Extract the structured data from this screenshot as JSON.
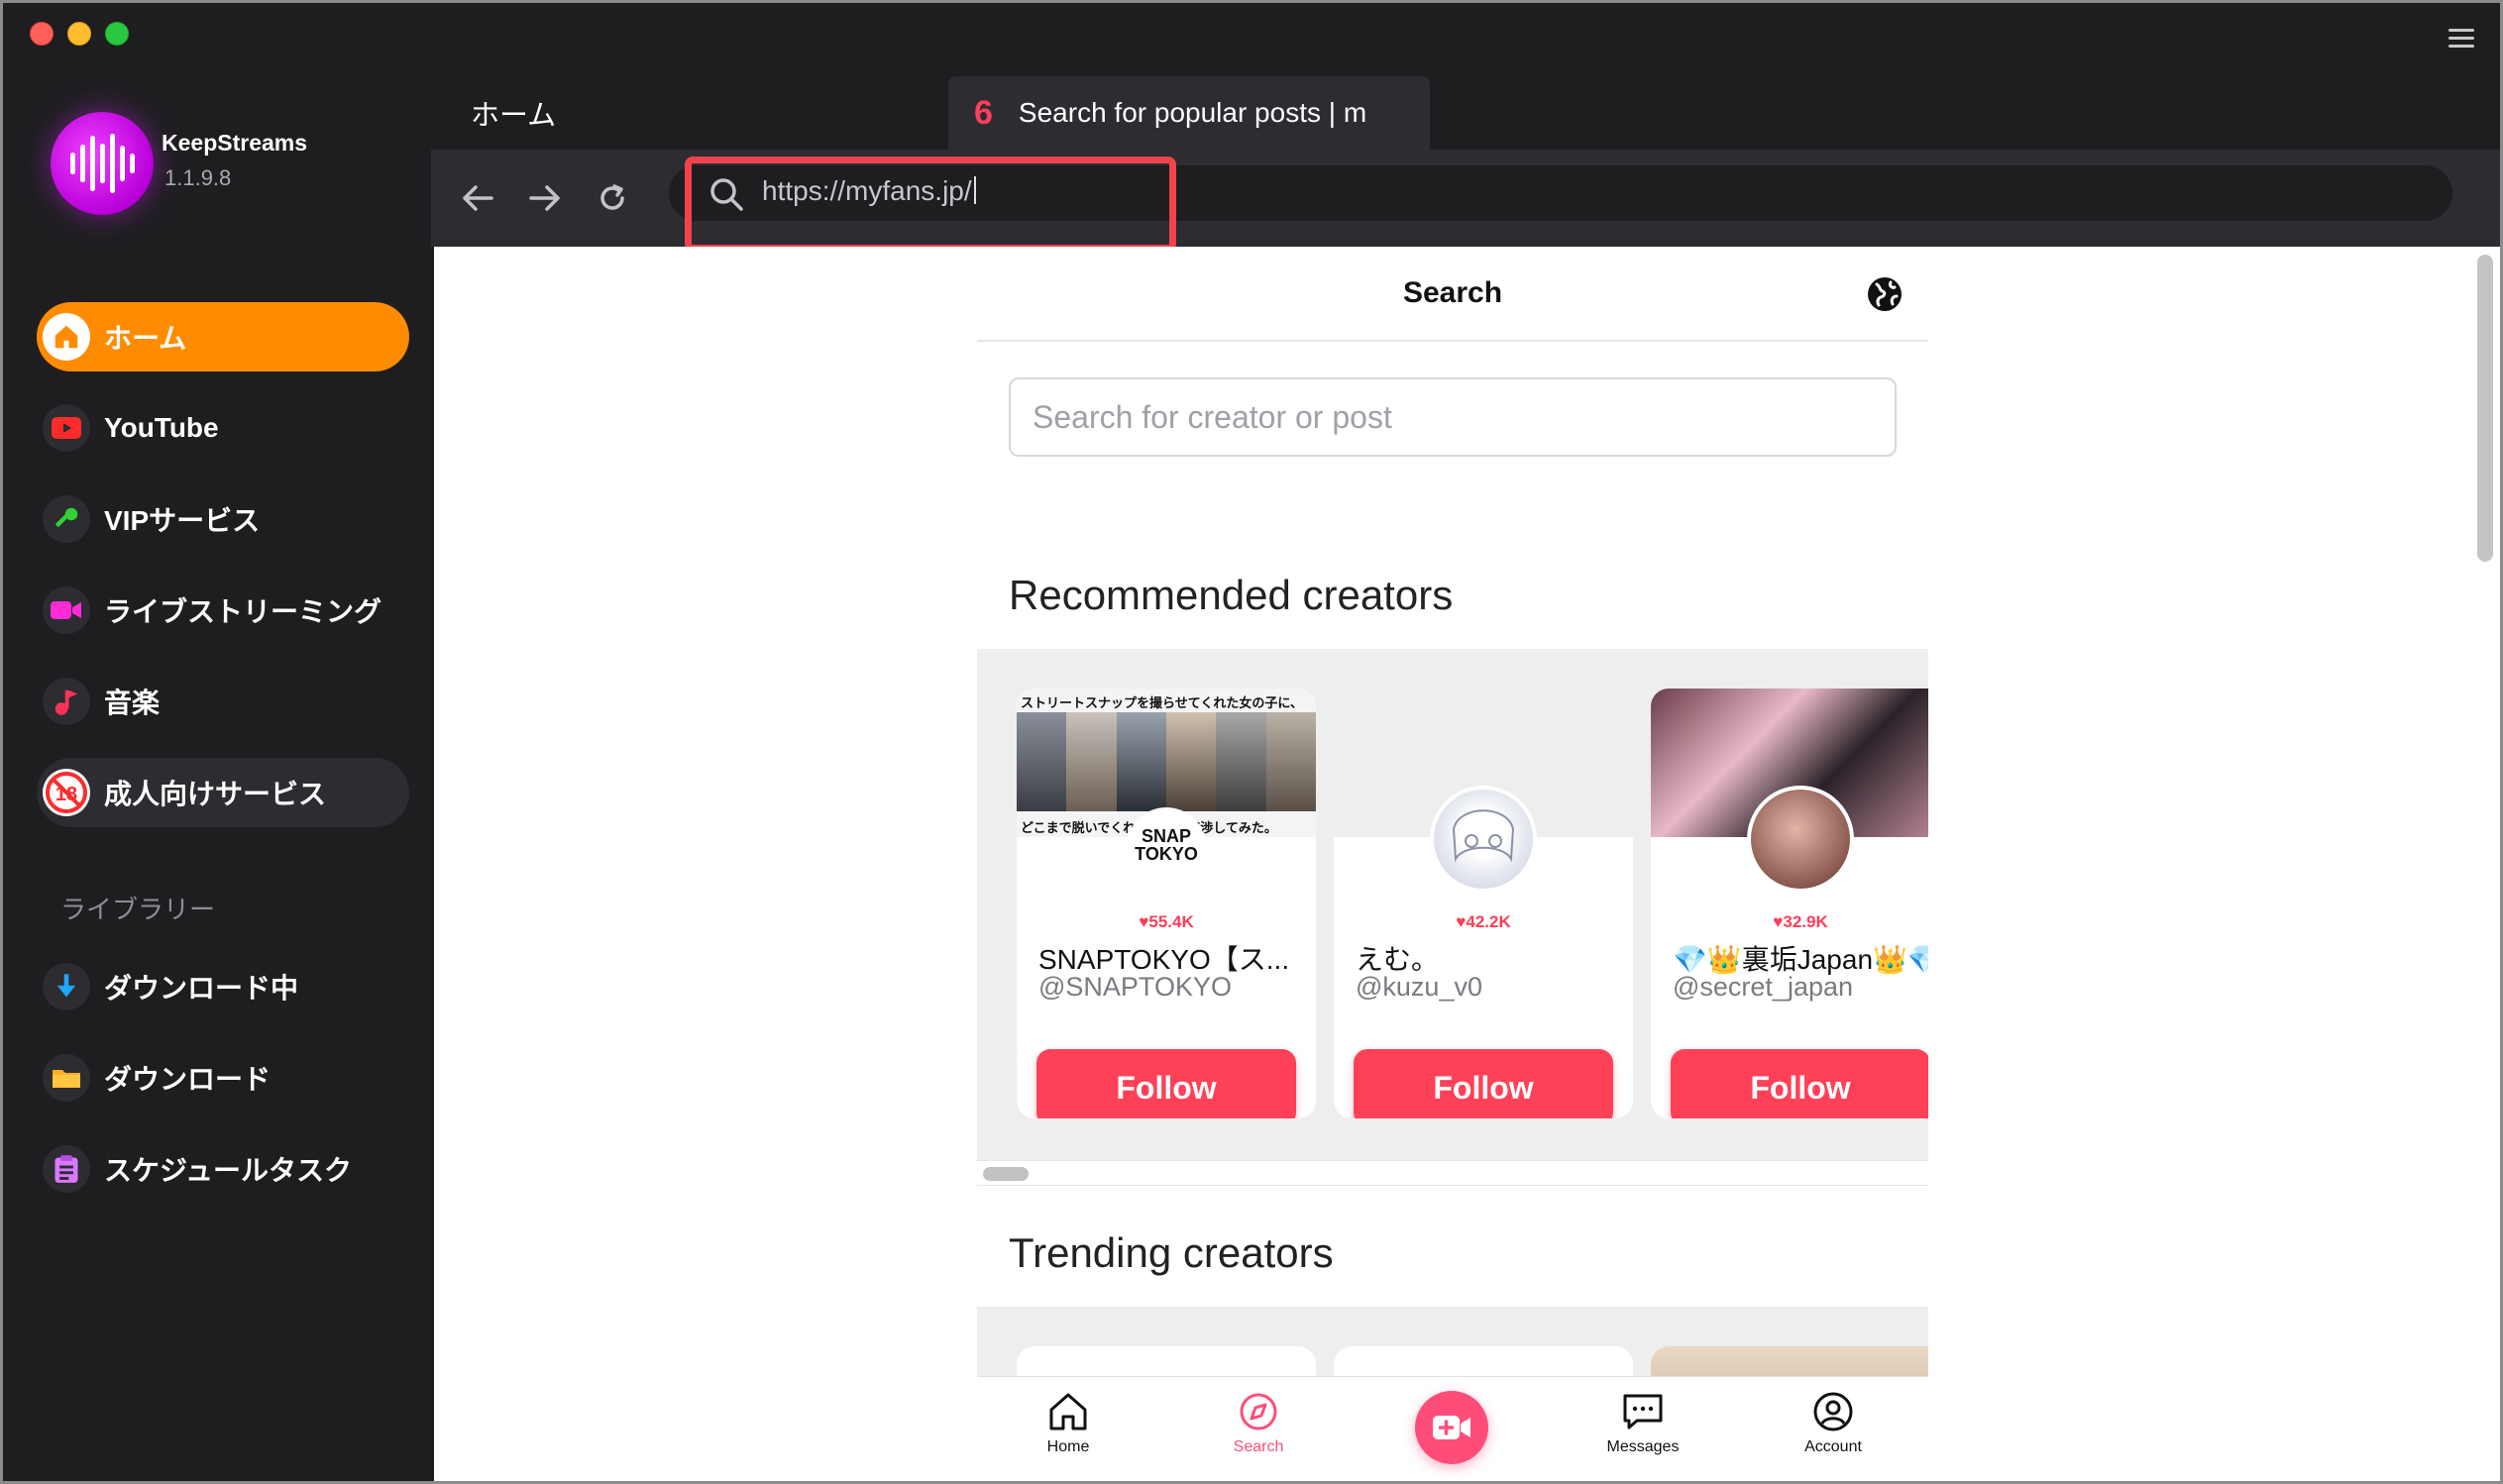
{
  "app": {
    "name": "KeepStreams",
    "version": "1.1.9.8"
  },
  "sidebar": {
    "items": [
      {
        "label": "ホーム",
        "icon": "home-icon"
      },
      {
        "label": "YouTube",
        "icon": "youtube-icon"
      },
      {
        "label": "VIPサービス",
        "icon": "key-icon"
      },
      {
        "label": "ライブストリーミング",
        "icon": "video-camera-icon"
      },
      {
        "label": "音楽",
        "icon": "music-note-icon"
      },
      {
        "label": "成人向けサービス",
        "icon": "adult-18-icon"
      }
    ],
    "library_label": "ライブラリー",
    "library_items": [
      {
        "label": "ダウンロード中",
        "icon": "download-arrow-icon"
      },
      {
        "label": "ダウンロード",
        "icon": "folder-icon"
      },
      {
        "label": "スケジュールタスク",
        "icon": "clipboard-icon"
      }
    ]
  },
  "tabs": {
    "home_label": "ホーム",
    "page_title": "Search for popular posts | m",
    "page_favicon": "6"
  },
  "address": {
    "url": "https://myfans.jp/"
  },
  "page": {
    "title": "Search",
    "search_placeholder": "Search for creator or post",
    "recommended_title": "Recommended creators",
    "trending_title": "Trending creators",
    "follow_label": "Follow",
    "creators": [
      {
        "name": "SNAPTOKYO【ス...",
        "handle": "@SNAPTOKYO",
        "likes": "♥55.4K",
        "cover_text_top": "ストリートスナップを撮らせてくれた女の子に、",
        "cover_text_bottom": "どこまで脱いでくれるかガチ交渉してみた。",
        "avatar_text": "SNAP TOKYO"
      },
      {
        "name": "えむ。",
        "handle": "@kuzu_v0",
        "likes": "♥42.2K"
      },
      {
        "name": "💎👑裏垢Japan👑💎",
        "handle": "@secret_japan",
        "likes": "♥32.9K"
      }
    ],
    "bottom_nav": [
      {
        "label": "Home",
        "icon": "house-icon"
      },
      {
        "label": "Search",
        "icon": "compass-icon"
      },
      {
        "label": "",
        "icon": "video-plus-icon"
      },
      {
        "label": "Messages",
        "icon": "chat-bubble-icon"
      },
      {
        "label": "Account",
        "icon": "user-circle-icon"
      }
    ]
  },
  "colors": {
    "accent": "#ff8c00",
    "brand_pink": "#ff4158",
    "url_highlight": "#f0434b",
    "sidebar_bg": "#1e1e21"
  }
}
